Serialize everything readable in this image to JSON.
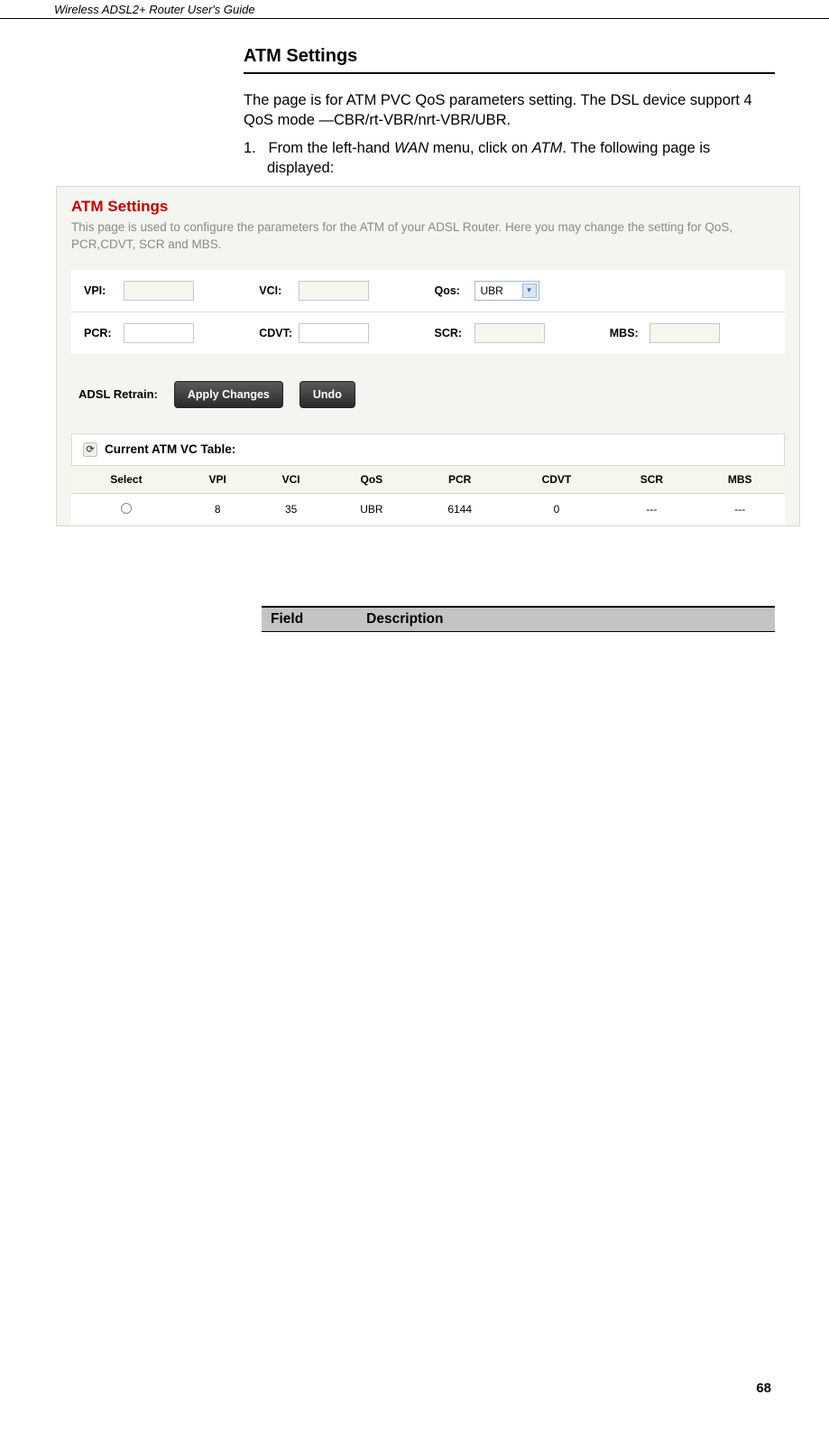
{
  "header": "Wireless ADSL2+ Router User's Guide",
  "section_title": "ATM Settings",
  "intro": "The page is for ATM PVC QoS parameters setting. The DSL device support 4 QoS mode —CBR/rt-VBR/nrt-VBR/UBR.",
  "step_num": "1.",
  "step_text_a": "From the left-hand ",
  "step_wan": "WAN",
  "step_text_b": " menu, click on ",
  "step_atm": "ATM",
  "step_text_c": ". The following page is displayed:",
  "ss": {
    "title": "ATM Settings",
    "desc": "This page is used to configure the parameters for the ATM of your ADSL Router. Here you may change the setting for QoS, PCR,CDVT, SCR and MBS.",
    "labels": {
      "vpi": "VPI:",
      "vci": "VCI:",
      "qos": "Qos:",
      "pcr": "PCR:",
      "cdvt": "CDVT:",
      "scr": "SCR:",
      "mbs": "MBS:"
    },
    "qos_selected": "UBR",
    "retrain_label": "ADSL Retrain:",
    "btn_apply": "Apply Changes",
    "btn_undo": "Undo",
    "table_title": "Current ATM VC Table:",
    "cols": [
      "Select",
      "VPI",
      "VCI",
      "QoS",
      "PCR",
      "CDVT",
      "SCR",
      "MBS"
    ],
    "row": [
      "",
      "8",
      "35",
      "UBR",
      "6144",
      "0",
      "---",
      "---"
    ]
  },
  "field_desc": {
    "field": "Field",
    "description": "Description"
  },
  "page_number": "68"
}
